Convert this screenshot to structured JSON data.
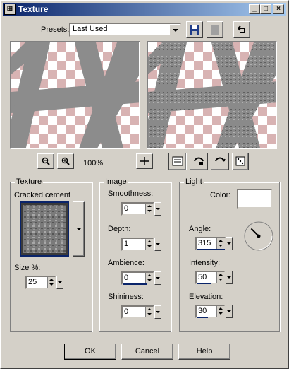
{
  "window": {
    "title": "Texture",
    "min_glyph": "_",
    "max_glyph": "□",
    "close_glyph": "×",
    "app_glyph": "⊞"
  },
  "presets": {
    "label": "Presets:",
    "value": "Last Used"
  },
  "toolbar_icons": [
    "save-icon",
    "delete-icon",
    "reset-icon"
  ],
  "zoom": {
    "value": "100%",
    "zoom_out_glyph": "🔍",
    "zoom_in_glyph": "🔍",
    "pan_glyph": "✛"
  },
  "texture": {
    "group_label": "Texture",
    "name": "Cracked cement",
    "size_label": "Size %:",
    "size_value": "25"
  },
  "image": {
    "group_label": "Image",
    "smoothness_label": "Smoothness:",
    "smoothness_value": "0",
    "depth_label": "Depth:",
    "depth_value": "1",
    "ambience_label": "Ambience:",
    "ambience_value": "0",
    "shininess_label": "Shininess:",
    "shininess_value": "0"
  },
  "light": {
    "group_label": "Light",
    "color_label": "Color:",
    "color_value": "#ffffff",
    "angle_label": "Angle:",
    "angle_value": "315",
    "intensity_label": "Intensity:",
    "intensity_value": "50",
    "elevation_label": "Elevation:",
    "elevation_value": "30"
  },
  "buttons": {
    "ok": "OK",
    "cancel": "Cancel",
    "help": "Help"
  },
  "colors": {
    "titlebar_start": "#0a246a",
    "titlebar_end": "#a6caf0",
    "face": "#d4d0c8",
    "check_pink": "#d8b3b3",
    "stripe_gray": "#8c8c8c"
  }
}
